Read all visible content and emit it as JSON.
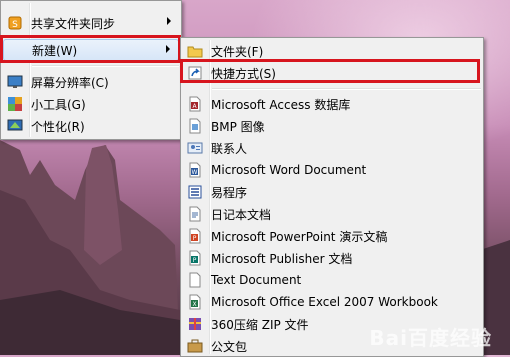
{
  "context_menu": {
    "items": [
      {
        "label": "共享文件夹同步",
        "icon": "sync-icon",
        "has_submenu": true
      },
      {
        "label": "新建(W)",
        "icon": "",
        "has_submenu": true,
        "highlighted": true
      },
      {
        "label": "屏幕分辨率(C)",
        "icon": "display-icon",
        "has_submenu": false
      },
      {
        "label": "小工具(G)",
        "icon": "gadgets-icon",
        "has_submenu": false
      },
      {
        "label": "个性化(R)",
        "icon": "personalize-icon",
        "has_submenu": false
      }
    ]
  },
  "new_submenu": {
    "items": [
      {
        "label": "文件夹(F)",
        "icon": "folder-icon"
      },
      {
        "label": "快捷方式(S)",
        "icon": "shortcut-icon",
        "highlighted": true
      },
      {
        "label": "Microsoft Access 数据库",
        "icon": "access-icon"
      },
      {
        "label": "BMP 图像",
        "icon": "bmp-image-icon"
      },
      {
        "label": "联系人",
        "icon": "contact-icon"
      },
      {
        "label": "Microsoft Word Document",
        "icon": "word-icon"
      },
      {
        "label": "易程序",
        "icon": "e-program-icon"
      },
      {
        "label": "日记本文档",
        "icon": "journal-icon"
      },
      {
        "label": "Microsoft PowerPoint 演示文稿",
        "icon": "powerpoint-icon"
      },
      {
        "label": "Microsoft Publisher 文档",
        "icon": "publisher-icon"
      },
      {
        "label": "Text Document",
        "icon": "text-doc-icon"
      },
      {
        "label": "Microsoft Office Excel 2007 Workbook",
        "icon": "excel-icon"
      },
      {
        "label": "360压缩 ZIP 文件",
        "icon": "zip-icon"
      },
      {
        "label": "公文包",
        "icon": "briefcase-icon"
      }
    ]
  },
  "annotation_color": "#d7151e",
  "watermark": "Bai百度经验"
}
